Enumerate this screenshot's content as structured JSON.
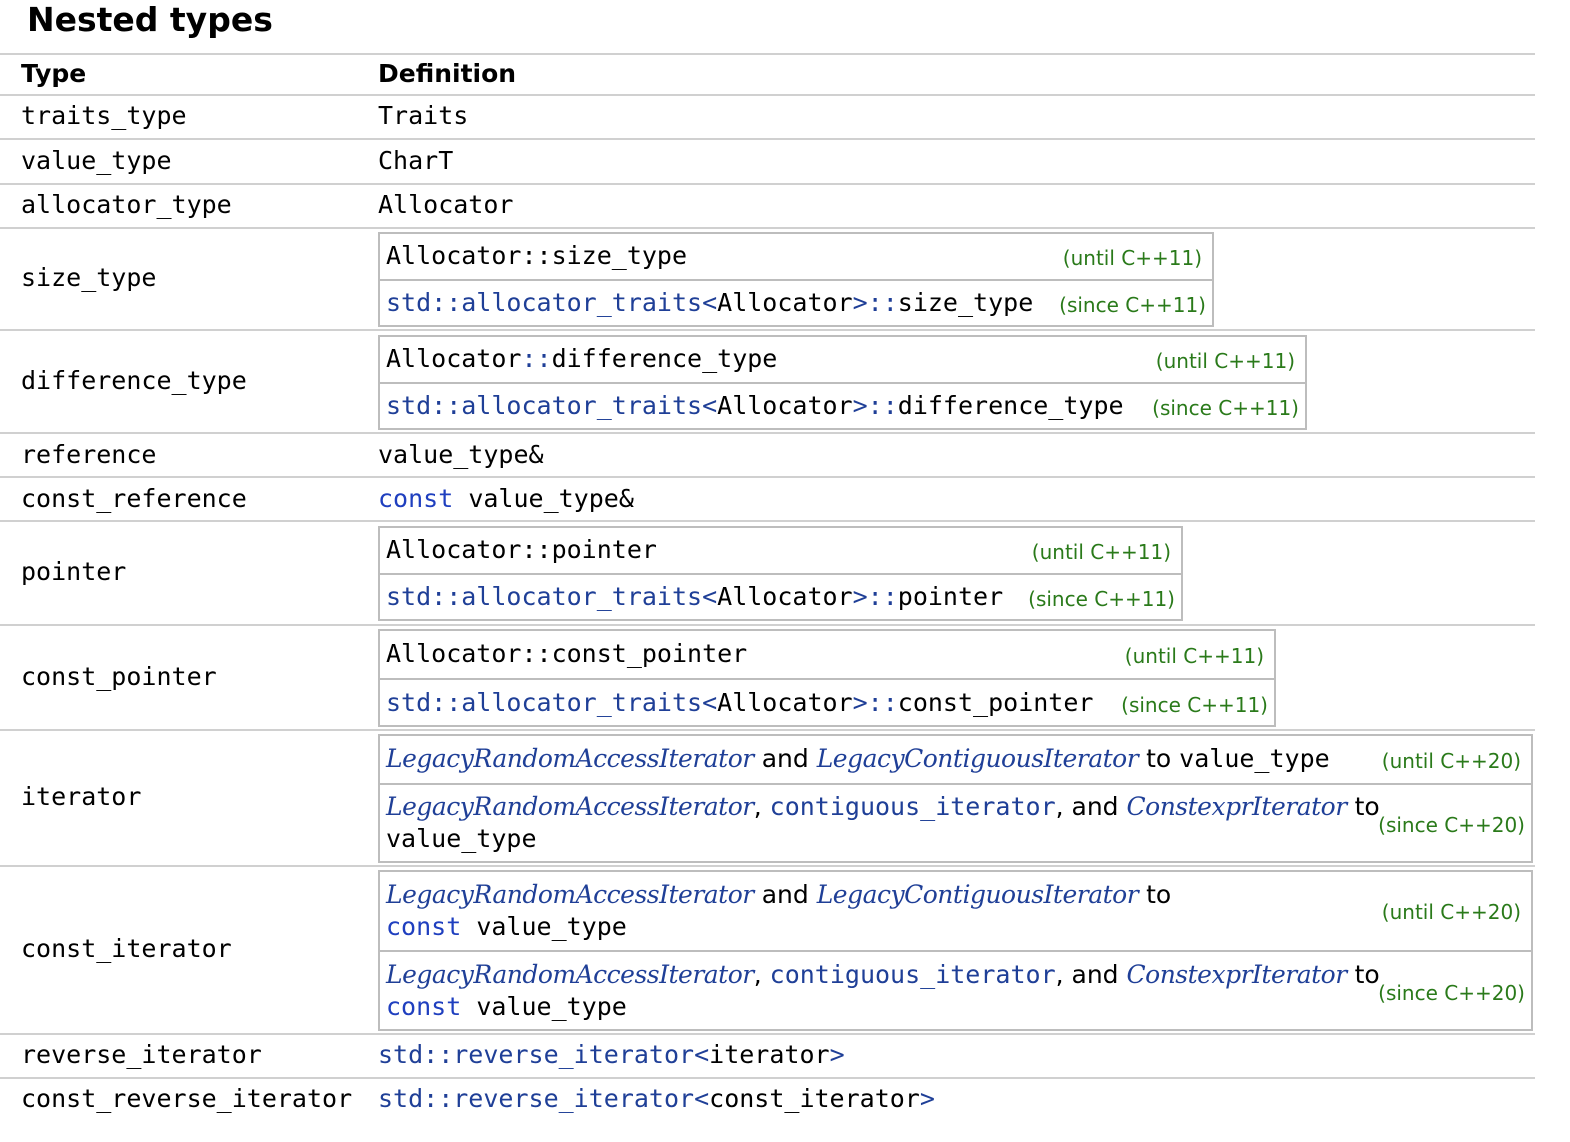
{
  "page": {
    "title": "Nested types",
    "header": {
      "type": "Type",
      "definition": "Definition"
    }
  },
  "rows": {
    "traits_type": {
      "name": "traits_type",
      "def": "Traits"
    },
    "value_type": {
      "name": "value_type",
      "def": "CharT"
    },
    "allocator_type": {
      "name": "allocator_type",
      "def": "Allocator"
    },
    "size_type": {
      "name": "size_type",
      "until": {
        "code": "Allocator::size_type",
        "mark": "(until C++11)"
      },
      "since": {
        "ns": "std::allocator_traits",
        "lt": "<",
        "arg": "Allocator",
        "gt": ">",
        "sep": "::",
        "member": "size_type",
        "mark": "(since C++11)"
      }
    },
    "difference_type": {
      "name": "difference_type",
      "until": {
        "cls": "Allocator",
        "sep": "::",
        "member": "difference_type",
        "mark": "(until C++11)"
      },
      "since": {
        "ns": "std::allocator_traits",
        "lt": "<",
        "arg": "Allocator",
        "gt": ">",
        "sep": "::",
        "member": "difference_type",
        "mark": "(since C++11)"
      }
    },
    "reference": {
      "name": "reference",
      "def": "value_type&"
    },
    "const_reference": {
      "name": "const_reference",
      "kw": "const",
      "def": "value_type&"
    },
    "pointer": {
      "name": "pointer",
      "until": {
        "code": "Allocator::pointer",
        "mark": "(until C++11)"
      },
      "since": {
        "ns": "std::allocator_traits",
        "lt": "<",
        "arg": "Allocator",
        "gt": ">",
        "sep": "::",
        "member": "pointer",
        "mark": "(since C++11)"
      }
    },
    "const_pointer": {
      "name": "const_pointer",
      "until": {
        "code": "Allocator::const_pointer",
        "mark": "(until C++11)"
      },
      "since": {
        "ns": "std::allocator_traits",
        "lt": "<",
        "arg": "Allocator",
        "gt": ">",
        "sep": "::",
        "member": "const_pointer",
        "mark": "(since C++11)"
      }
    },
    "iterator": {
      "name": "iterator",
      "until": {
        "link1": "LegacyRandomAccessIterator",
        "and": "and",
        "link2": "LegacyContiguousIterator",
        "to": "to",
        "target": "value_type",
        "mark": "(until C++20)"
      },
      "since": {
        "link1": "LegacyRandomAccessIterator",
        "comma1": ",",
        "concept": "contiguous_iterator",
        "comma_and": ", and",
        "link2": "ConstexprIterator",
        "to": "to",
        "target": "value_type",
        "mark": "(since C++20)"
      }
    },
    "const_iterator": {
      "name": "const_iterator",
      "until": {
        "link1": "LegacyRandomAccessIterator",
        "and": "and",
        "link2": "LegacyContiguousIterator",
        "to": "to",
        "kw": "const",
        "target": "value_type",
        "mark": "(until C++20)"
      },
      "since": {
        "link1": "LegacyRandomAccessIterator",
        "comma1": ",",
        "concept": "contiguous_iterator",
        "comma_and": ", and",
        "link2": "ConstexprIterator",
        "to": "to",
        "kw": "const",
        "target": "value_type",
        "mark": "(since C++20)"
      }
    },
    "reverse_iterator": {
      "name": "reverse_iterator",
      "ns": "std::reverse_iterator",
      "lt": "<",
      "arg": "iterator",
      "gt": ">"
    },
    "const_reverse_iterator": {
      "name": "const_reverse_iterator",
      "ns": "std::reverse_iterator",
      "lt": "<",
      "arg": "const_iterator",
      "gt": ">"
    }
  }
}
